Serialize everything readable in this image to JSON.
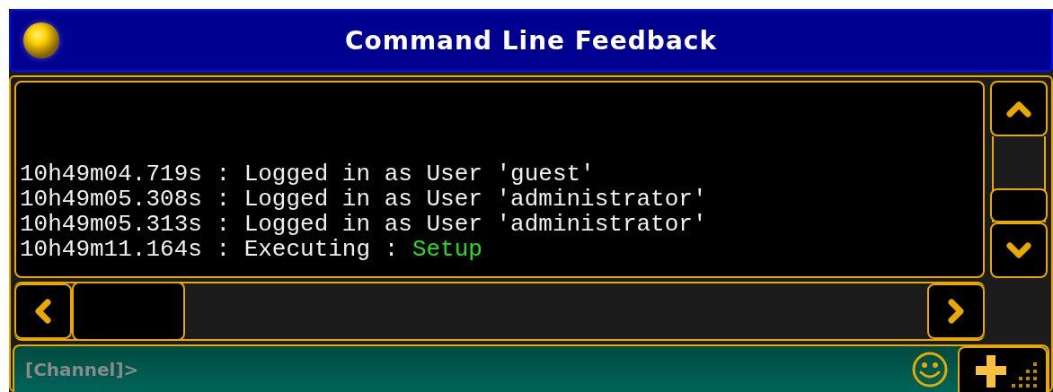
{
  "window": {
    "title": "Command Line Feedback"
  },
  "log": {
    "lines": [
      {
        "text": "10h49m04.719s : Logged in as User 'guest'"
      },
      {
        "text": "10h49m05.308s : Logged in as User 'administrator'"
      },
      {
        "text": "10h49m05.313s : Logged in as User 'administrator'"
      },
      {
        "text": "10h49m11.164s : Executing :",
        "argument": "Setup"
      }
    ]
  },
  "command_line": {
    "placeholder": "[Channel]>"
  }
}
